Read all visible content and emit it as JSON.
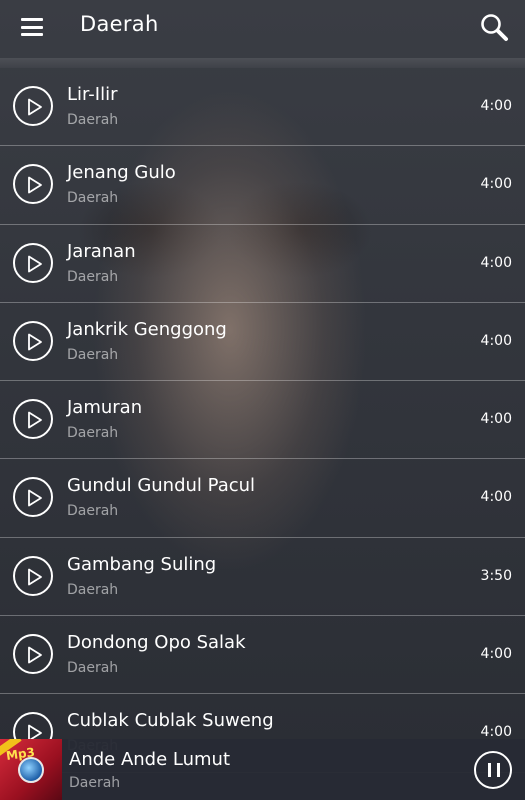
{
  "app": {
    "title": "Daerah"
  },
  "songs": [
    {
      "title": "Lir-Ilir",
      "subtitle": "Daerah",
      "duration": "4:00"
    },
    {
      "title": "Jenang Gulo",
      "subtitle": "Daerah",
      "duration": "4:00"
    },
    {
      "title": "Jaranan",
      "subtitle": "Daerah",
      "duration": "4:00"
    },
    {
      "title": "Jankrik Genggong",
      "subtitle": "Daerah",
      "duration": "4:00"
    },
    {
      "title": "Jamuran",
      "subtitle": "Daerah",
      "duration": "4:00"
    },
    {
      "title": "Gundul Gundul Pacul",
      "subtitle": "Daerah",
      "duration": "4:00"
    },
    {
      "title": "Gambang Suling",
      "subtitle": "Daerah",
      "duration": "3:50"
    },
    {
      "title": "Dondong Opo Salak",
      "subtitle": "Daerah",
      "duration": "4:00"
    },
    {
      "title": "Cublak Cublak Suweng",
      "subtitle": "Daerah",
      "duration": "4:00"
    }
  ],
  "now_playing": {
    "title": "Ande Ande Lumut",
    "subtitle": "Daerah",
    "art_text": "Mp3",
    "state": "playing"
  },
  "icons": {
    "menu": "menu-icon",
    "search": "search-icon",
    "play": "play-icon",
    "pause": "pause-icon"
  },
  "colors": {
    "text": "#ffffff",
    "subtext": "#9a9ba0",
    "divider": "#7d7f85",
    "bar_bg": "#282b34"
  }
}
